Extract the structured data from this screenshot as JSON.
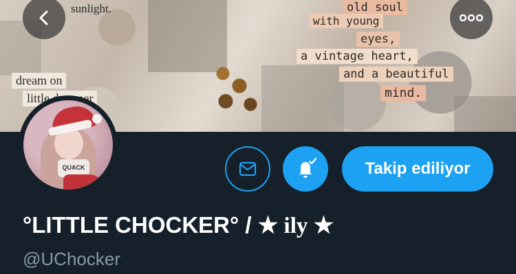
{
  "banner": {
    "collage_texts": [
      "sunlight.",
      "old soul",
      "with young",
      "eyes,",
      "a vintage heart,",
      "and a beautiful",
      "mind.",
      "dream on",
      "little dreamer"
    ]
  },
  "nav": {
    "back_icon": "chevron-left-icon",
    "more_icon": "more-horizontal-icon"
  },
  "profile": {
    "avatar_text": "QUACK",
    "display_name": "°LITTLE CHOCKER° /",
    "display_name_suffix": "★ ily ★",
    "handle": "@UChocker"
  },
  "actions": {
    "message_icon": "envelope-icon",
    "notify_icon": "bell-check-icon",
    "follow_label": "Takip ediliyor"
  },
  "colors": {
    "background": "#15202b",
    "accent": "#1da1f2",
    "secondary_text": "#8899a6"
  }
}
